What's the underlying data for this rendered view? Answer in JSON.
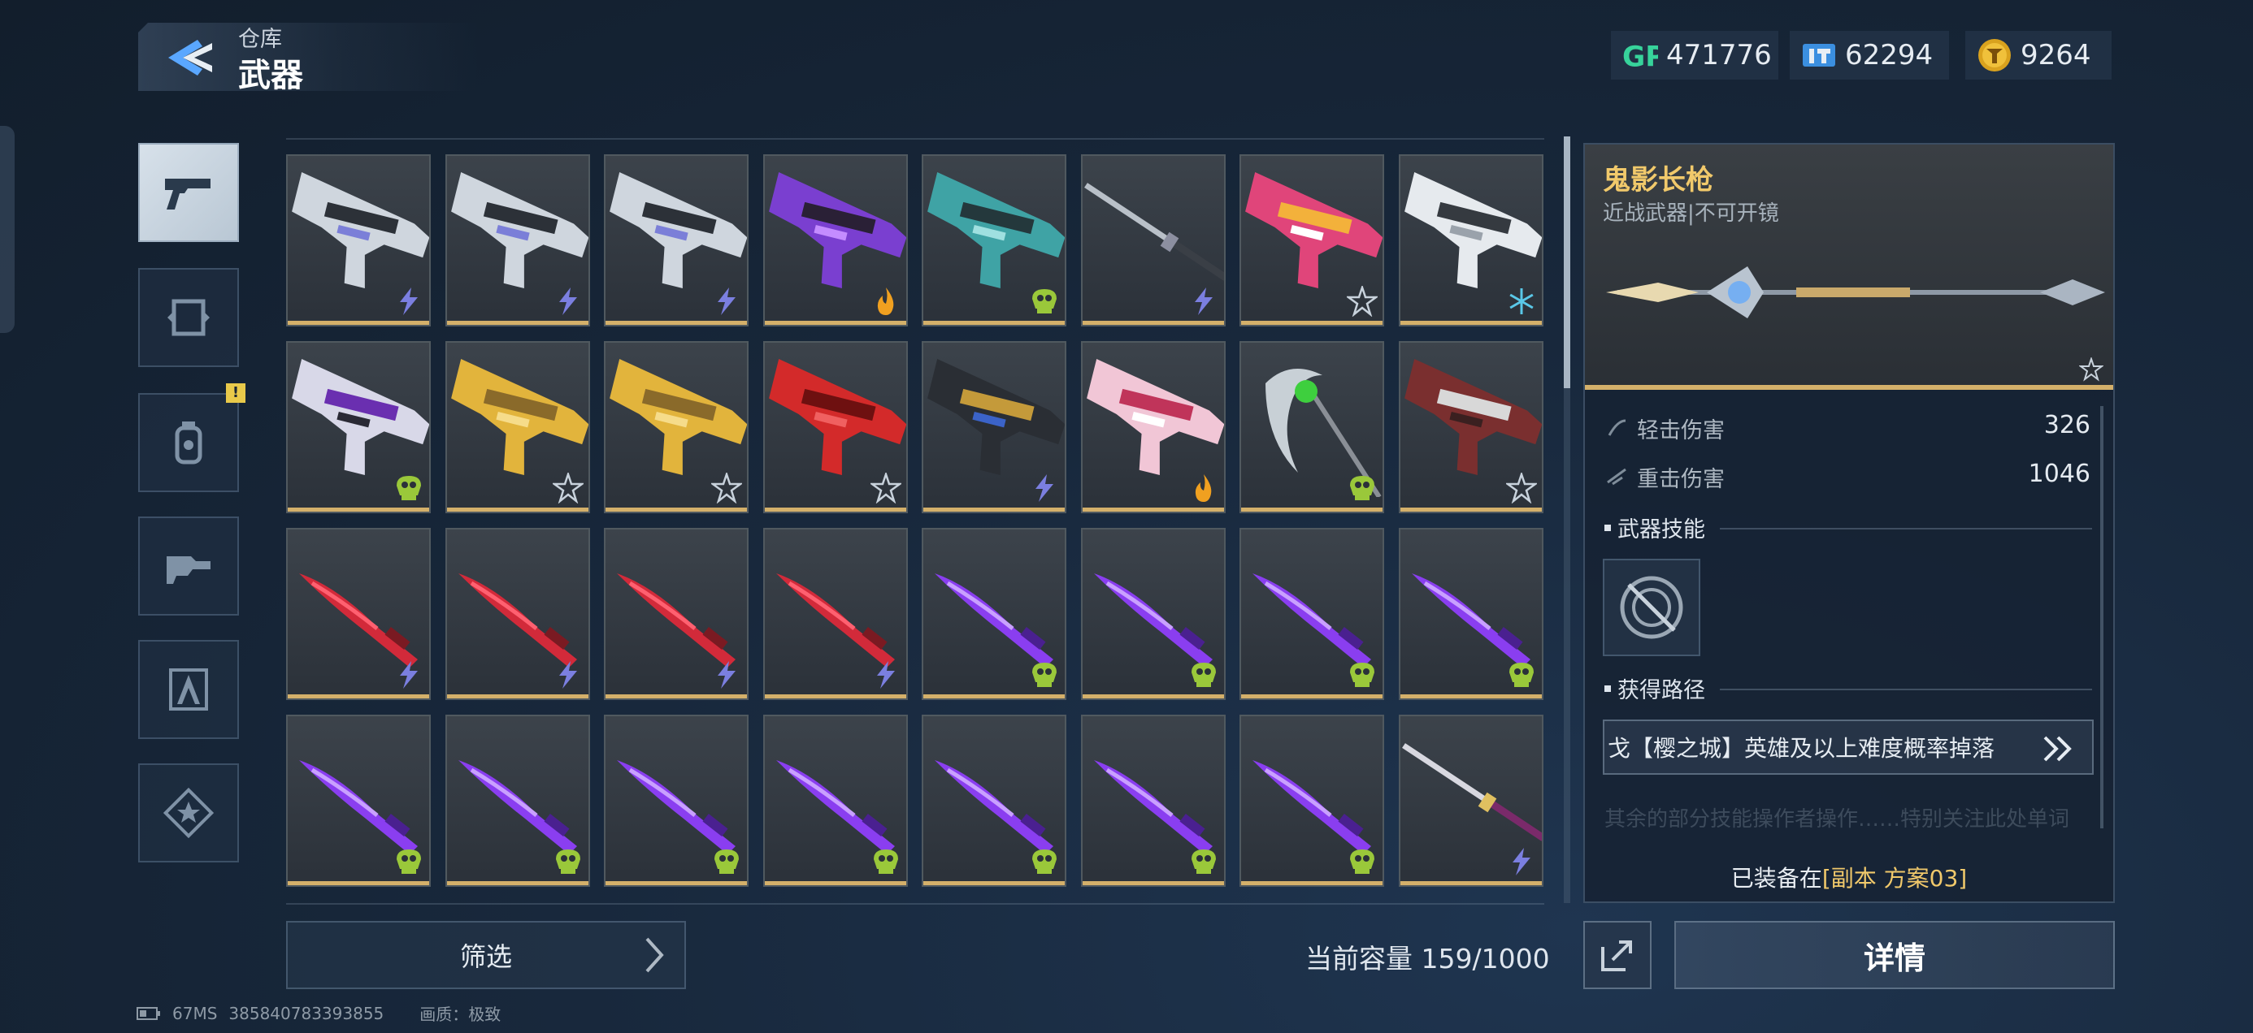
{
  "header": {
    "breadcrumb": "仓库",
    "title": "武器"
  },
  "currencies": [
    {
      "icon": "gp-icon",
      "value": "471776"
    },
    {
      "icon": "ticket-icon",
      "value": "62294"
    },
    {
      "icon": "gold-coin-icon",
      "value": "9264"
    }
  ],
  "sidebar": {
    "tabs": [
      {
        "icon": "pistol-icon",
        "active": true
      },
      {
        "icon": "frame-icon",
        "active": false
      },
      {
        "icon": "grenade-icon",
        "active": false,
        "alert": "!"
      },
      {
        "icon": "gear-swap-icon",
        "active": false
      },
      {
        "icon": "compass-tool-icon",
        "active": false
      },
      {
        "icon": "star-badge-icon",
        "active": false
      }
    ]
  },
  "weapons": [
    {
      "art": "rifle-silver",
      "badge": "lightning"
    },
    {
      "art": "rifle-silver",
      "badge": "lightning"
    },
    {
      "art": "rifle-silver",
      "badge": "lightning"
    },
    {
      "art": "rifle-purple",
      "badge": "flame"
    },
    {
      "art": "rifle-teal",
      "badge": "skull"
    },
    {
      "art": "spear-silver",
      "badge": "lightning"
    },
    {
      "art": "smg-pink",
      "badge": "star"
    },
    {
      "art": "launcher-white",
      "badge": "snowflake"
    },
    {
      "art": "rifle-violet",
      "badge": "skull"
    },
    {
      "art": "smg-gold",
      "badge": "star"
    },
    {
      "art": "smg-gold",
      "badge": "star"
    },
    {
      "art": "rifle-red",
      "badge": "star"
    },
    {
      "art": "sniper-dark",
      "badge": "lightning"
    },
    {
      "art": "rifle-pink",
      "badge": "flame"
    },
    {
      "art": "scythe-green",
      "badge": "skull"
    },
    {
      "art": "rifle-crimson",
      "badge": "star"
    },
    {
      "art": "blade-red",
      "badge": "lightning"
    },
    {
      "art": "blade-red",
      "badge": "lightning"
    },
    {
      "art": "blade-red",
      "badge": "lightning"
    },
    {
      "art": "blade-red",
      "badge": "lightning"
    },
    {
      "art": "blade-purple",
      "badge": "skull"
    },
    {
      "art": "blade-purple",
      "badge": "skull"
    },
    {
      "art": "blade-purple",
      "badge": "skull"
    },
    {
      "art": "blade-purple",
      "badge": "skull"
    },
    {
      "art": "blade-purple",
      "badge": "skull"
    },
    {
      "art": "blade-purple",
      "badge": "skull"
    },
    {
      "art": "blade-purple",
      "badge": "skull"
    },
    {
      "art": "blade-purple",
      "badge": "skull"
    },
    {
      "art": "blade-purple",
      "badge": "skull"
    },
    {
      "art": "blade-purple",
      "badge": "skull"
    },
    {
      "art": "blade-purple",
      "badge": "skull"
    },
    {
      "art": "katana",
      "badge": "lightning"
    }
  ],
  "detail": {
    "name": "鬼影长枪",
    "type": "近战武器|不可开镜",
    "stats": [
      {
        "label": "轻击伤害",
        "value": "326"
      },
      {
        "label": "重击伤害",
        "value": "1046"
      }
    ],
    "skill_title": "武器技能",
    "route_title": "获得路径",
    "route_text": "戈【樱之城】英雄及以上难度概率掉落",
    "faded_text": "其余的部分技能操作者操作……特别关注此处单词",
    "equip_prefix": "已装备在",
    "equip_loadout": "[副本 方案03]"
  },
  "footer": {
    "filter_label": "筛选",
    "capacity": "当前容量 159/1000",
    "details_label": "详情"
  },
  "status": {
    "ping": "67MS",
    "id": "385840783393855",
    "quality": "画质：极致"
  },
  "colors": {
    "accent_gold": "#d4b06a",
    "name_gold": "#f1c96b"
  }
}
